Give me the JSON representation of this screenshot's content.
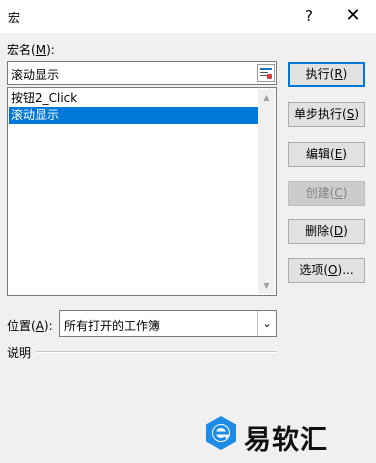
{
  "window": {
    "title": "宏",
    "help_glyph": "?",
    "close_glyph": "✕"
  },
  "macro_name": {
    "label": "宏名",
    "hotkey": "M",
    "value": "滚动显示"
  },
  "macro_list": {
    "items": [
      "按钮2_Click",
      "滚动显示"
    ],
    "selected_index": 1
  },
  "buttons": {
    "run": {
      "label": "执行",
      "hotkey": "R"
    },
    "step": {
      "label": "单步执行",
      "hotkey": "S"
    },
    "edit": {
      "label": "编辑",
      "hotkey": "E"
    },
    "create": {
      "label": "创建",
      "hotkey": "C",
      "enabled": false
    },
    "delete": {
      "label": "删除",
      "hotkey": "D"
    },
    "options": {
      "label": "选项",
      "hotkey": "O",
      "suffix": "..."
    }
  },
  "location": {
    "label": "位置",
    "hotkey": "A",
    "value": "所有打开的工作簿"
  },
  "description": {
    "label": "说明"
  },
  "watermark": {
    "text": "易软汇"
  },
  "colors": {
    "selection": "#0078d7",
    "watermark_icon": "#1e8ce6"
  }
}
